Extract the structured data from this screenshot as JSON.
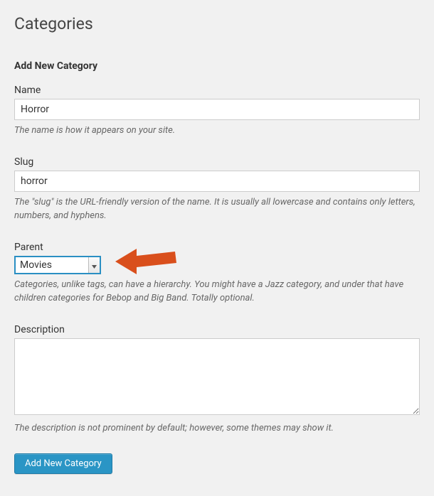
{
  "page": {
    "title": "Categories",
    "section_title": "Add New Category"
  },
  "fields": {
    "name": {
      "label": "Name",
      "value": "Horror",
      "hint": "The name is how it appears on your site."
    },
    "slug": {
      "label": "Slug",
      "value": "horror",
      "hint": "The \"slug\" is the URL-friendly version of the name. It is usually all lowercase and contains only letters, numbers, and hyphens."
    },
    "parent": {
      "label": "Parent",
      "value": "Movies",
      "hint": "Categories, unlike tags, can have a hierarchy. You might have a Jazz category, and under that have children categories for Bebop and Big Band. Totally optional."
    },
    "description": {
      "label": "Description",
      "value": "",
      "hint": "The description is not prominent by default; however, some themes may show it."
    }
  },
  "submit": {
    "label": "Add New Category"
  },
  "colors": {
    "accent": "#2a95c5",
    "arrow": "#d94f1c"
  }
}
